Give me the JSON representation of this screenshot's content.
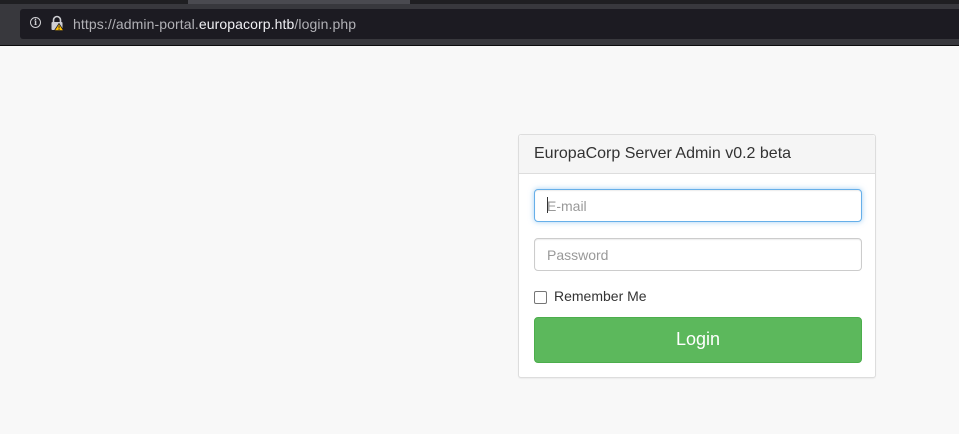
{
  "browser": {
    "url_prefix": "https://admin-portal.",
    "url_domain": "europacorp.htb",
    "url_path": "/login.php",
    "icons": [
      "info-icon",
      "lock-warning-icon"
    ]
  },
  "panel": {
    "title": "EuropaCorp Server Admin v0.2 beta"
  },
  "form": {
    "email_placeholder": "E-mail",
    "email_value": "",
    "password_placeholder": "Password",
    "password_value": "",
    "remember_label": "Remember Me",
    "remember_checked": false,
    "login_label": "Login"
  },
  "colors": {
    "button": "#5cb85c",
    "focus": "#66afe9",
    "background": "#f8f8f8"
  }
}
